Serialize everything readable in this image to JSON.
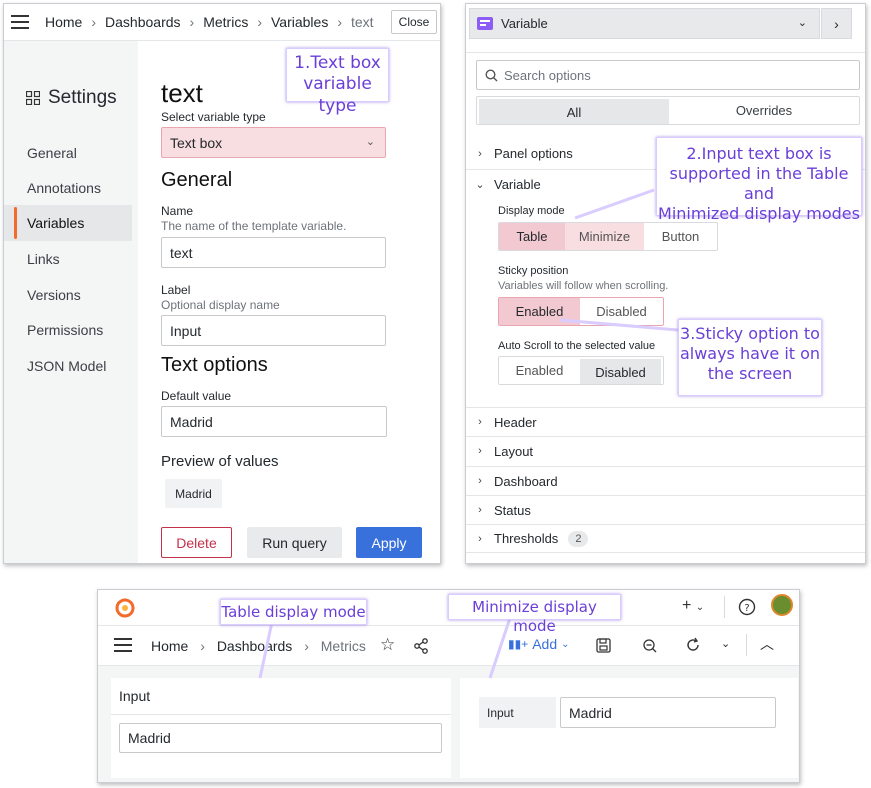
{
  "settings_panel": {
    "hamburger": "menu-icon",
    "breadcrumb": [
      "Home",
      "Dashboards",
      "Metrics",
      "Variables"
    ],
    "breadcrumb_current": "text",
    "close_label": "Close",
    "settings_title": "Settings",
    "nav": [
      "General",
      "Annotations",
      "Variables",
      "Links",
      "Versions",
      "Permissions",
      "JSON Model"
    ],
    "nav_active": "Variables",
    "var_title": "text",
    "select_type_label": "Select variable type",
    "select_type_value": "Text box",
    "general_heading": "General",
    "name_label": "Name",
    "name_desc": "The name of the template variable.",
    "name_value": "text",
    "label_label": "Label",
    "label_desc": "Optional display name",
    "label_value": "Input",
    "text_options_heading": "Text options",
    "default_label": "Default value",
    "default_value": "Madrid",
    "preview_label": "Preview of values",
    "preview_chip": "Madrid",
    "delete_label": "Delete",
    "run_query_label": "Run query",
    "apply_label": "Apply"
  },
  "options_panel": {
    "viz_name": "Variable",
    "search_placeholder": "Search options",
    "tabs": [
      "All",
      "Overrides"
    ],
    "sections_top": [
      "Panel options",
      "Variable"
    ],
    "display_mode_label": "Display mode",
    "display_mode_options": [
      "Table",
      "Minimize",
      "Button"
    ],
    "sticky_label": "Sticky position",
    "sticky_desc": "Variables will follow when scrolling.",
    "sticky_options": [
      "Enabled",
      "Disabled"
    ],
    "autoscroll_label": "Auto Scroll to the selected value",
    "autoscroll_options": [
      "Enabled",
      "Disabled"
    ],
    "sections_bottom": [
      "Header",
      "Layout",
      "Dashboard",
      "Status",
      "Thresholds"
    ],
    "thresholds_count": "2"
  },
  "dashboard_panel": {
    "breadcrumb": [
      "Home",
      "Dashboards"
    ],
    "breadcrumb_current": "Metrics",
    "add_label": "Add",
    "table_title": "Input",
    "table_value": "Madrid",
    "min_label": "Input",
    "min_value": "Madrid"
  },
  "callouts": {
    "c1": [
      "1.Text box",
      "variable type"
    ],
    "c2": [
      "2.Input text box is",
      "supported in the Table and",
      "Minimized display modes"
    ],
    "c3": [
      "3.Sticky option to",
      "always have it on",
      "the screen"
    ],
    "c4": "Table display mode",
    "c5": "Minimize display mode"
  },
  "colors": {
    "accent_blue": "#3871dc",
    "active_orange": "#f46a2c",
    "highlight_pink": "#f8dde1",
    "callout_purple": "#6a3fd8",
    "delete_red": "#c4314b",
    "viz_purple": "#8b5cf6"
  }
}
